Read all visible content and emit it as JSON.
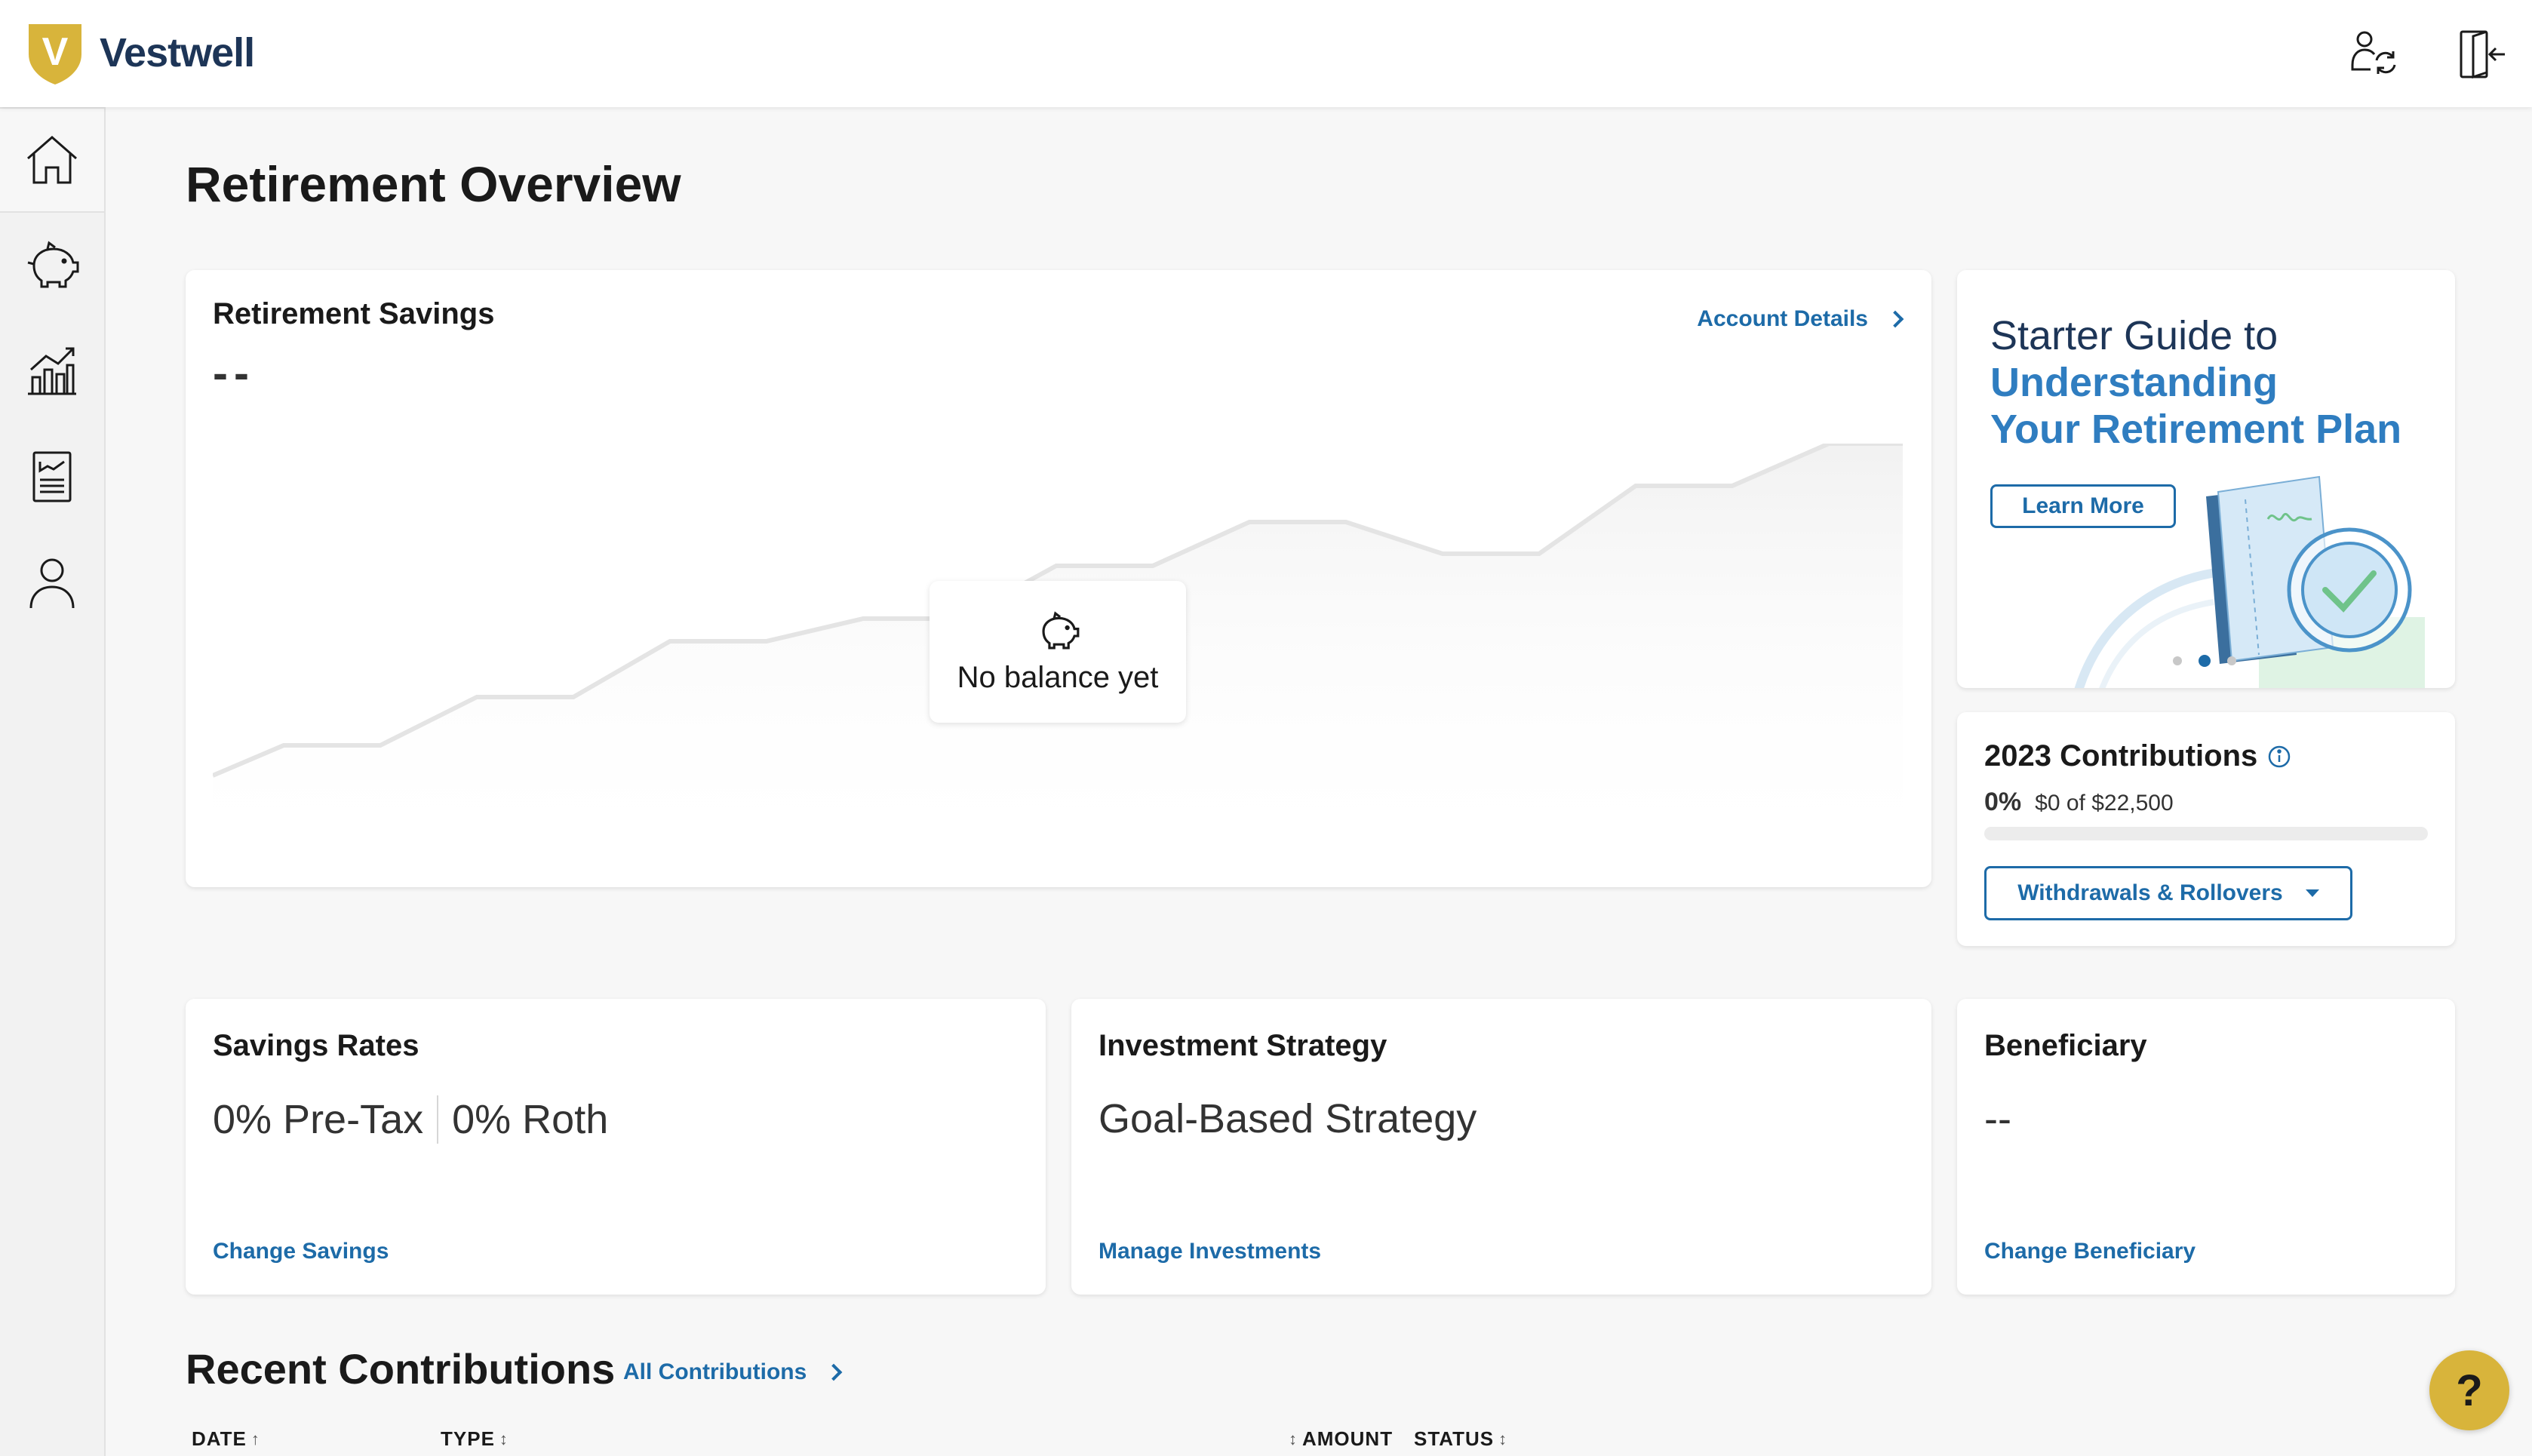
{
  "header": {
    "brand": "Vestwell",
    "logo_letter": "V",
    "switch_icon": "user-switch-icon",
    "logout_icon": "logout-icon"
  },
  "sidebar": {
    "items": [
      {
        "name": "home",
        "icon": "home-icon",
        "active": true
      },
      {
        "name": "savings",
        "icon": "piggy-bank-icon",
        "active": false
      },
      {
        "name": "investments",
        "icon": "chart-growth-icon",
        "active": false
      },
      {
        "name": "documents",
        "icon": "document-icon",
        "active": false
      },
      {
        "name": "profile",
        "icon": "user-icon",
        "active": false
      }
    ]
  },
  "page": {
    "title": "Retirement Overview"
  },
  "retirement_savings": {
    "title": "Retirement Savings",
    "balance": "--",
    "account_details_link": "Account Details",
    "empty_state": "No balance yet"
  },
  "guide": {
    "line1": "Starter Guide to",
    "line2": "Understanding",
    "line3": "Your Retirement Plan",
    "button": "Learn More",
    "carousel_active_index": 1,
    "carousel_count": 3
  },
  "contributions": {
    "title": "2023 Contributions",
    "percent": "0%",
    "amount": "$0 of $22,500",
    "progress_fraction": 0,
    "button": "Withdrawals & Rollovers"
  },
  "savings_rates": {
    "title": "Savings Rates",
    "pre_tax": "0% Pre-Tax",
    "roth": "0% Roth",
    "link": "Change Savings"
  },
  "investment_strategy": {
    "title": "Investment Strategy",
    "value": "Goal-Based Strategy",
    "link": "Manage Investments"
  },
  "beneficiary": {
    "title": "Beneficiary",
    "value": "--",
    "link": "Change Beneficiary"
  },
  "recent_contributions": {
    "title": "Recent Contributions",
    "link": "All Contributions",
    "columns": [
      "DATE",
      "TYPE",
      "AMOUNT",
      "STATUS"
    ]
  },
  "help": {
    "label": "?"
  },
  "colors": {
    "brand_navy": "#1d3557",
    "link_blue": "#1d6ba8",
    "accent_gold": "#d8b43b"
  }
}
